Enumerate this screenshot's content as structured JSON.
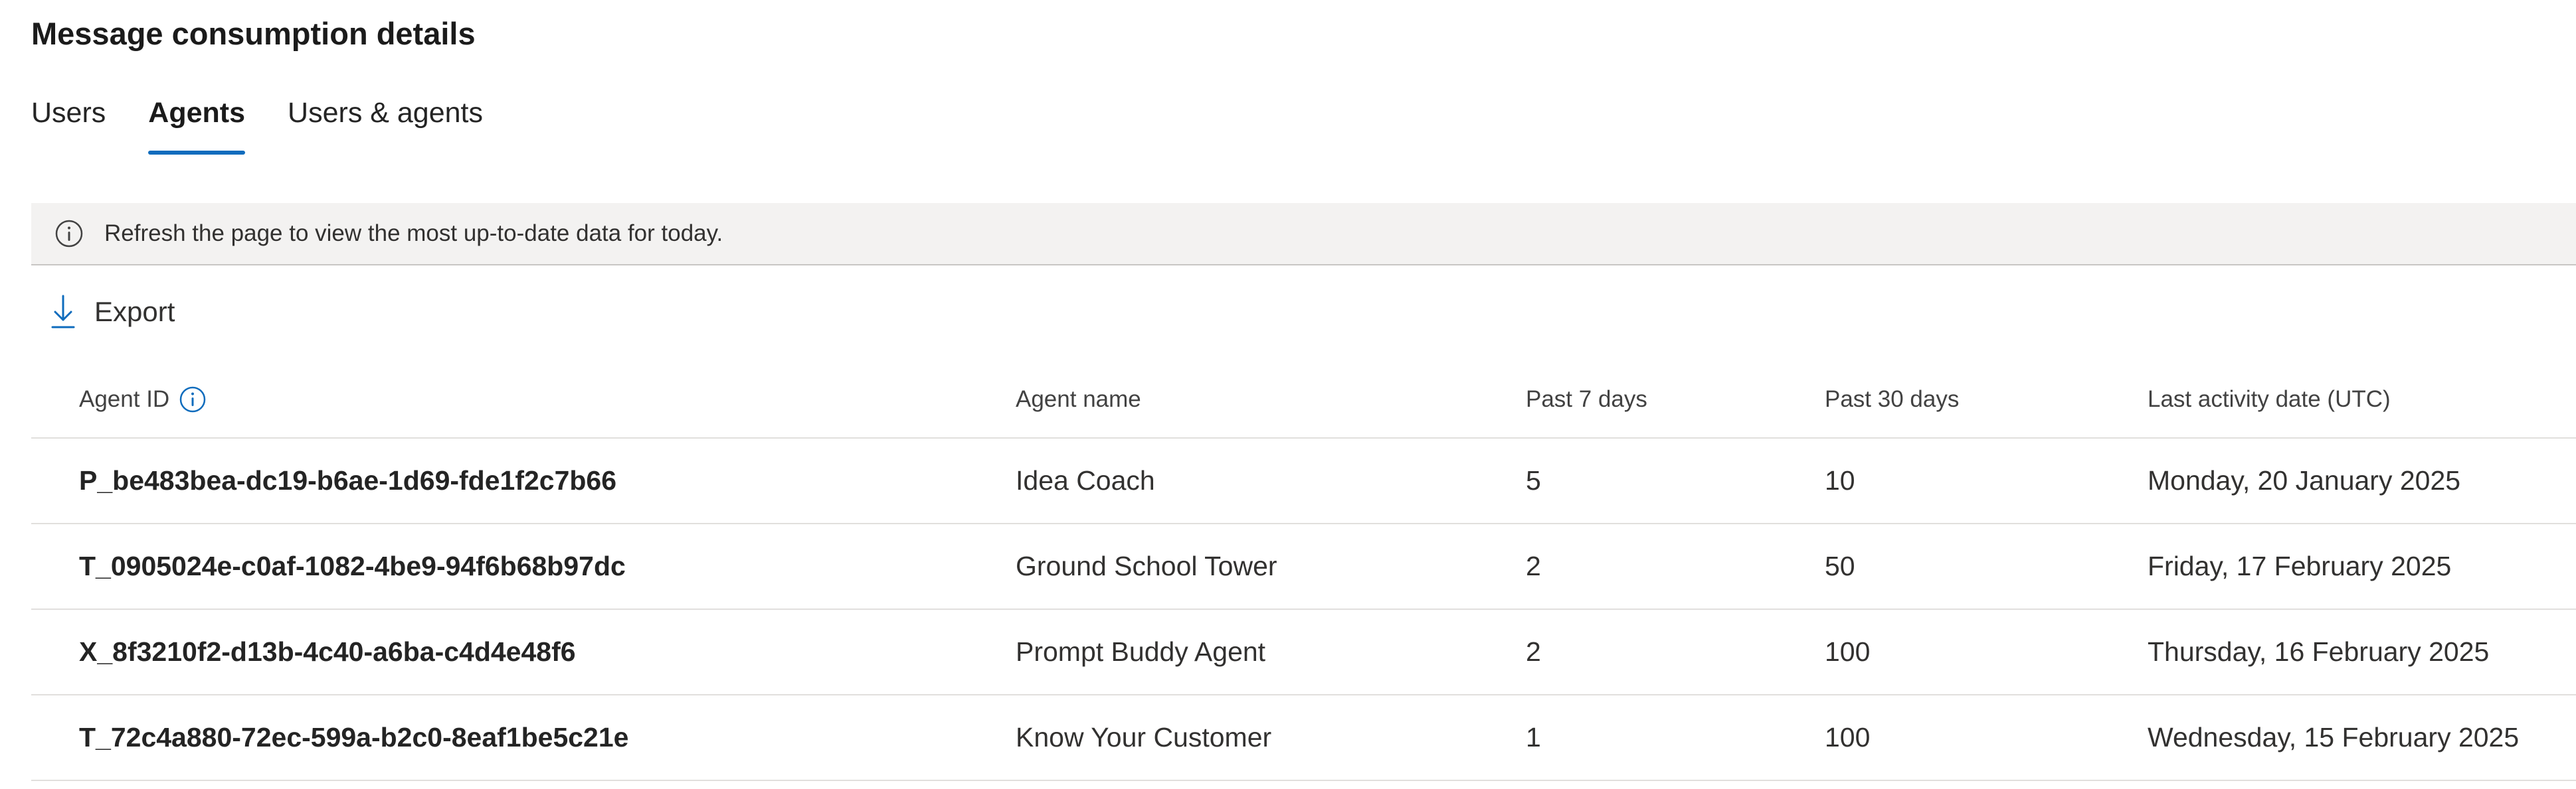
{
  "page": {
    "title": "Message consumption details"
  },
  "tabs": [
    {
      "label": "Users",
      "active": false
    },
    {
      "label": "Agents",
      "active": true
    },
    {
      "label": "Users & agents",
      "active": false
    }
  ],
  "banner": {
    "icon": "info-icon",
    "text": "Refresh the page to view the most up-to-date data for today."
  },
  "toolbar": {
    "export_icon": "download-icon",
    "export_label": "Export"
  },
  "table": {
    "columns": {
      "agent_id": "Agent ID",
      "agent_name": "Agent name",
      "past_7": "Past 7 days",
      "past_30": "Past 30 days",
      "last_activity": "Last activity date (UTC)"
    },
    "rows": [
      {
        "agent_id": "P_be483bea-dc19-b6ae-1d69-fde1f2c7b66",
        "agent_name": "Idea Coach",
        "past_7": "5",
        "past_30": "10",
        "last_activity": "Monday, 20 January 2025"
      },
      {
        "agent_id": "T_0905024e-c0af-1082-4be9-94f6b68b97dc",
        "agent_name": "Ground School Tower",
        "past_7": "2",
        "past_30": "50",
        "last_activity": "Friday, 17 February 2025"
      },
      {
        "agent_id": "X_8f3210f2-d13b-4c40-a6ba-c4d4e48f6",
        "agent_name": "Prompt Buddy Agent",
        "past_7": "2",
        "past_30": "100",
        "last_activity": "Thursday, 16 February 2025"
      },
      {
        "agent_id": "T_72c4a880-72ec-599a-b2c0-8eaf1be5c21e",
        "agent_name": "Know Your Customer",
        "past_7": "1",
        "past_30": "100",
        "last_activity": "Wednesday, 15 February 2025"
      }
    ]
  },
  "colors": {
    "accent": "#0f6cbd",
    "banner_bg": "#f3f2f1",
    "divider": "#e1dfdd"
  }
}
